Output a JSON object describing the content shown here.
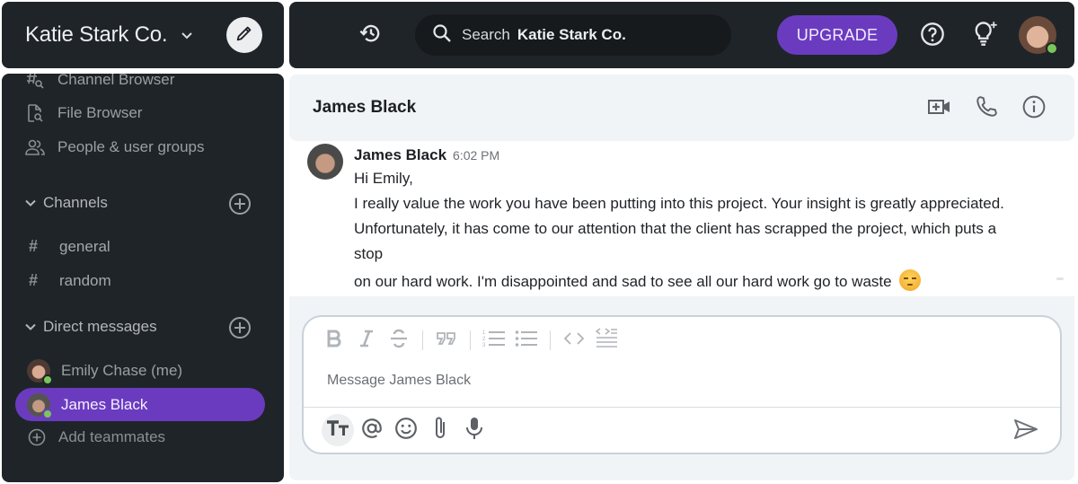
{
  "workspace": {
    "name": "Katie Stark Co.",
    "chevron_icon": "chevron-down-icon",
    "compose_icon": "pencil-icon"
  },
  "topbar": {
    "history_icon": "history-icon",
    "search": {
      "label": "Search",
      "scope": "Katie Stark Co."
    },
    "upgrade_label": "UPGRADE",
    "help_icon": "help-icon",
    "tips_icon": "lightbulb-icon",
    "user_status": "online"
  },
  "sidebar": {
    "nav": [
      {
        "label": "Channel Browser",
        "icon": "channel-browser-icon"
      },
      {
        "label": "File Browser",
        "icon": "file-search-icon"
      },
      {
        "label": "People & user groups",
        "icon": "people-icon"
      }
    ],
    "channels": {
      "title": "Channels",
      "items": [
        {
          "label": "general"
        },
        {
          "label": "random"
        }
      ]
    },
    "direct_messages": {
      "title": "Direct messages",
      "items": [
        {
          "label": "Emily Chase (me)",
          "status": "online",
          "active": false
        },
        {
          "label": "James Black",
          "status": "online",
          "active": true
        }
      ],
      "add_label": "Add teammates"
    }
  },
  "chat": {
    "title": "James Black",
    "actions": [
      "video-call-icon",
      "phone-icon",
      "info-icon"
    ],
    "messages": [
      {
        "author": "James Black",
        "time": "6:02 PM",
        "lines": [
          "Hi Emily,",
          "I really value the work you have been putting into this project. Your insight is greatly appreciated.",
          "Unfortunately, it has come to our attention that the client has scrapped the project, which puts a",
          "stop",
          "on our hard work. I'm disappointed and sad to see all our hard work go to waste"
        ],
        "emoji": "pensive-face"
      }
    ]
  },
  "composer": {
    "placeholder": "Message James Black",
    "format_tools": [
      "bold",
      "italic",
      "strikethrough",
      "quote",
      "numbered-list",
      "bulleted-list",
      "code",
      "code-block"
    ],
    "actions": [
      "text-format",
      "mention",
      "emoji",
      "attachment",
      "microphone"
    ],
    "send_icon": "send-icon"
  },
  "colors": {
    "sidebar_bg": "#1f2429",
    "accent": "#6b3bbf",
    "online": "#7ac65a",
    "chat_header_bg": "#f1f4f7"
  }
}
